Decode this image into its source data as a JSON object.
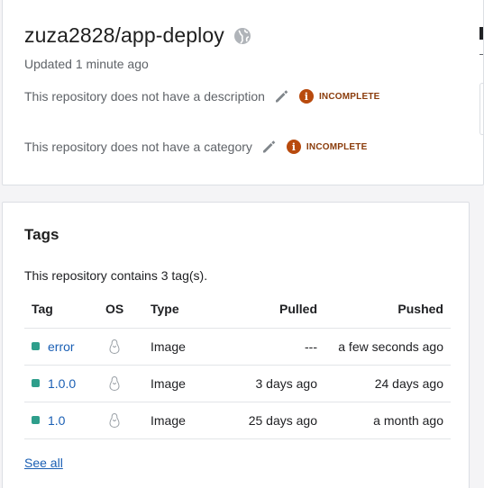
{
  "repository": {
    "title": "zuza2828/app-deploy",
    "updated": "Updated 1 minute ago",
    "description_text": "This repository does not have a description",
    "category_text": "This repository does not have a category",
    "badge_label": "INCOMPLETE",
    "badge_icon_glyph": "i",
    "visibility_icon": "globe-icon"
  },
  "tags": {
    "heading": "Tags",
    "count_text": "This repository contains 3 tag(s).",
    "columns": {
      "tag": "Tag",
      "os": "OS",
      "type": "Type",
      "pulled": "Pulled",
      "pushed": "Pushed"
    },
    "rows": [
      {
        "tag": "error",
        "os_icon": "linux-icon",
        "type": "Image",
        "pulled": "---",
        "pushed": "a few seconds ago"
      },
      {
        "tag": "1.0.0",
        "os_icon": "linux-icon",
        "type": "Image",
        "pulled": "3 days ago",
        "pushed": "24 days ago"
      },
      {
        "tag": "1.0",
        "os_icon": "linux-icon",
        "type": "Image",
        "pulled": "25 days ago",
        "pushed": "a month ago"
      }
    ],
    "see_all": "See all"
  },
  "colors": {
    "link": "#1a5fb4",
    "tag_dot": "#2e9e8b",
    "badge_icon": "#b84a0d",
    "badge_text": "#8a3b0a"
  }
}
